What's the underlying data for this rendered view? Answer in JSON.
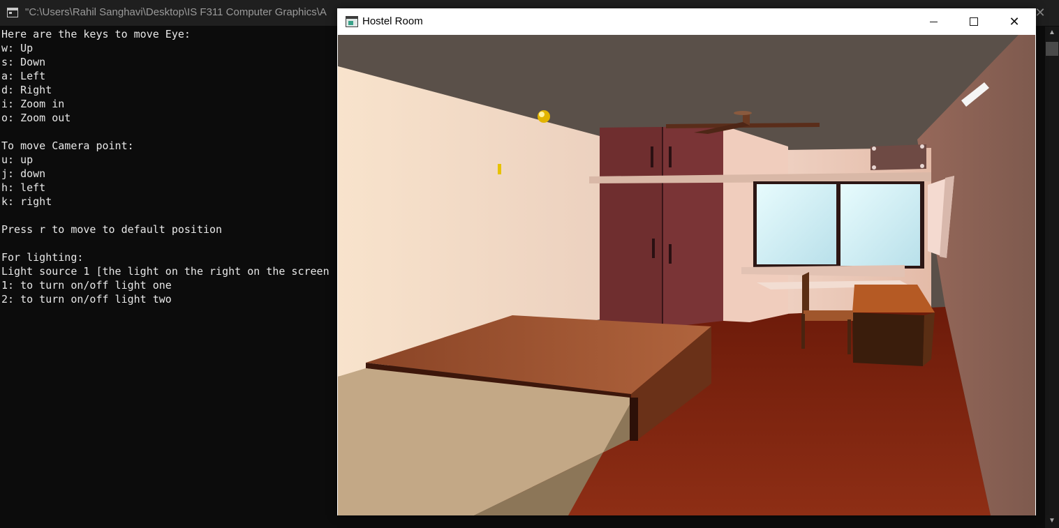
{
  "console": {
    "title": "\"C:\\Users\\Rahil Sanghavi\\Desktop\\IS F311 Computer Graphics\\A",
    "lines": [
      "Here are the keys to move Eye:",
      "w: Up",
      "s: Down",
      "a: Left",
      "d: Right",
      "i: Zoom in",
      "o: Zoom out",
      "",
      "To move Camera point:",
      "u: up",
      "j: down",
      "h: left",
      "k: right",
      "",
      "Press r to move to default position",
      "",
      "For lighting:",
      "Light source 1 [the light on the right on the screen",
      "1: to turn on/off light one",
      "2: to turn on/off light two"
    ],
    "close_glyph": "✕"
  },
  "window": {
    "title": "Hostel Room",
    "close_glyph": "✕"
  },
  "scrollbar": {
    "up_glyph": "▲",
    "down_glyph": "▼"
  }
}
